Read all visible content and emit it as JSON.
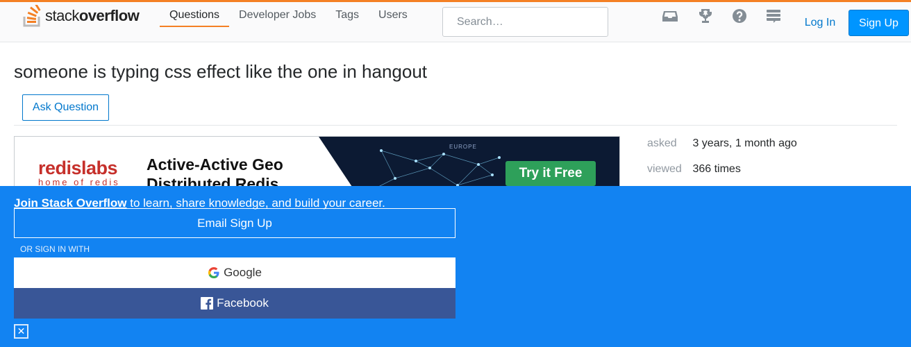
{
  "header": {
    "logo": {
      "word_light": "stack",
      "word_bold": "overflow"
    },
    "nav": [
      {
        "label": "Questions",
        "active": true
      },
      {
        "label": "Developer Jobs",
        "active": false
      },
      {
        "label": "Tags",
        "active": false
      },
      {
        "label": "Users",
        "active": false
      }
    ],
    "search_placeholder": "Search…",
    "icons": [
      "inbox-icon",
      "achievements-icon",
      "help-icon",
      "stackexchange-icon"
    ],
    "login_label": "Log In",
    "signup_label": "Sign Up",
    "accent_color": "#f48024"
  },
  "question": {
    "title": "someone is typing css effect like the one in hangout",
    "ask_label": "Ask Question",
    "asked_label": "asked",
    "asked_value": "3 years, 1 month ago",
    "viewed_label": "viewed",
    "viewed_value": "366 times"
  },
  "ad": {
    "brand": "redislabs",
    "brand_sub": "home of redis",
    "headline": "Active-Active Geo Distributed Redis",
    "map_label": "EUROPE",
    "cta": "Try it Free"
  },
  "banner": {
    "join_bold": "Join Stack Overflow",
    "join_rest": " to learn, share knowledge, and build your career.",
    "email_label": "Email Sign Up",
    "or_label": "OR SIGN IN WITH",
    "google_label": "Google",
    "facebook_label": "Facebook",
    "close_label": "✕",
    "color": "#1283f2"
  }
}
